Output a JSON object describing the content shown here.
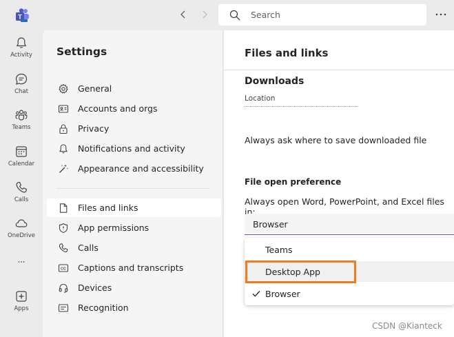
{
  "search": {
    "placeholder": "Search"
  },
  "rail": {
    "items": [
      {
        "label": "Activity",
        "icon": "bell-icon"
      },
      {
        "label": "Chat",
        "icon": "chat-icon"
      },
      {
        "label": "Teams",
        "icon": "teams-icon"
      },
      {
        "label": "Calendar",
        "icon": "calendar-icon"
      },
      {
        "label": "Calls",
        "icon": "phone-icon"
      },
      {
        "label": "OneDrive",
        "icon": "cloud-icon"
      },
      {
        "label": "",
        "icon": "more-icon"
      },
      {
        "label": "Apps",
        "icon": "apps-icon"
      }
    ]
  },
  "settings": {
    "title": "Settings",
    "items": [
      {
        "label": "General",
        "icon": "gear-icon"
      },
      {
        "label": "Accounts and orgs",
        "icon": "id-card-icon"
      },
      {
        "label": "Privacy",
        "icon": "lock-icon"
      },
      {
        "label": "Notifications and activity",
        "icon": "bell-icon"
      },
      {
        "label": "Appearance and accessibility",
        "icon": "wand-icon"
      },
      {
        "label": "Files and links",
        "icon": "document-icon"
      },
      {
        "label": "App permissions",
        "icon": "shield-icon"
      },
      {
        "label": "Calls",
        "icon": "phone-icon"
      },
      {
        "label": "Captions and transcripts",
        "icon": "cc-icon"
      },
      {
        "label": "Devices",
        "icon": "headset-icon"
      },
      {
        "label": "Recognition",
        "icon": "recognition-icon"
      }
    ],
    "active": "Files and links"
  },
  "content": {
    "title": "Files and links",
    "downloads_heading": "Downloads",
    "location_label": "Location",
    "ask_text": "Always ask where to save downloaded file",
    "file_open_heading": "File open preference",
    "file_open_desc": "Always open Word, PowerPoint, and Excel files in:",
    "dropdown_value": "Browser",
    "options": [
      {
        "label": "Teams",
        "selected": false
      },
      {
        "label": "Desktop App",
        "selected": false
      },
      {
        "label": "Browser",
        "selected": true
      }
    ]
  },
  "watermark": "CSDN @Kianteck",
  "colors": {
    "accent": "#5b5fc7",
    "highlight": "#f07b22"
  }
}
